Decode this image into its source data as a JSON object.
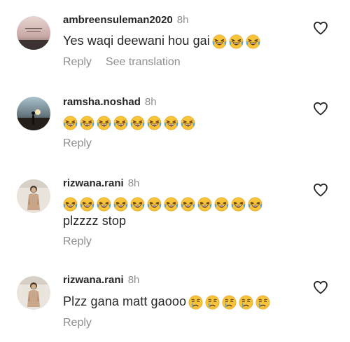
{
  "comments": [
    {
      "username": "ambreensuleman2020",
      "time": "8h",
      "text": "Yes waqi deewani hou gai",
      "emojis": [
        "laughing-tears",
        "laughing-tears",
        "laughing-tears"
      ],
      "actions": [
        "Reply",
        "See translation"
      ],
      "avatar_icon": "sunset-photo-avatar"
    },
    {
      "username": "ramsha.noshad",
      "time": "8h",
      "text": "",
      "emojis": [
        "laughing-tears",
        "laughing-tears",
        "laughing-tears",
        "laughing-tears",
        "laughing-tears",
        "laughing-tears",
        "laughing-tears",
        "laughing-tears"
      ],
      "actions": [
        "Reply"
      ],
      "avatar_icon": "silhouette-sunset-avatar"
    },
    {
      "username": "rizwana.rani",
      "time": "8h",
      "text": "plzzzz stop",
      "emojis": [
        "laughing-tears",
        "laughing-tears",
        "laughing-tears",
        "laughing-tears",
        "laughing-tears",
        "laughing-tears",
        "laughing-tears",
        "laughing-tears",
        "laughing-tears",
        "laughing-tears",
        "laughing-tears",
        "laughing-tears"
      ],
      "actions": [
        "Reply"
      ],
      "avatar_icon": "person-photo-avatar"
    },
    {
      "username": "rizwana.rani",
      "time": "8h",
      "text": "Plzz gana matt gaooo",
      "emojis": [
        "crying",
        "crying",
        "crying",
        "crying",
        "crying"
      ],
      "actions": [
        "Reply"
      ],
      "avatar_icon": "person-photo-avatar"
    }
  ],
  "icons": {
    "like": "heart-outline-icon"
  },
  "colors": {
    "text": "#262626",
    "muted": "#8e8e8e",
    "emoji_face": "#f7c53c"
  }
}
